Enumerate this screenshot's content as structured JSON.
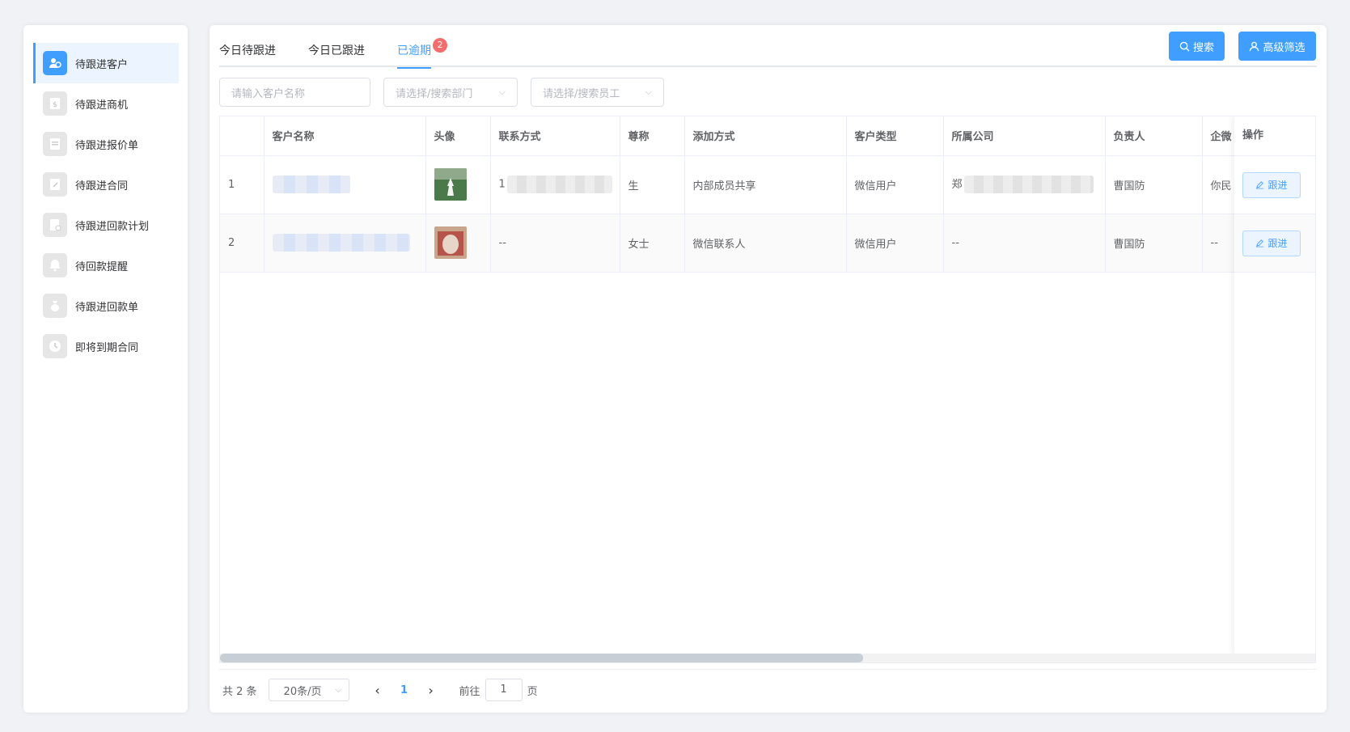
{
  "sidebar": {
    "items": [
      {
        "label": "待跟进客户",
        "icon": "customer-icon",
        "active": true
      },
      {
        "label": "待跟进商机",
        "icon": "opportunity-icon",
        "active": false
      },
      {
        "label": "待跟进报价单",
        "icon": "quote-icon",
        "active": false
      },
      {
        "label": "待跟进合同",
        "icon": "contract-icon",
        "active": false
      },
      {
        "label": "待跟进回款计划",
        "icon": "payment-plan-icon",
        "active": false
      },
      {
        "label": "待回款提醒",
        "icon": "bell-icon",
        "active": false
      },
      {
        "label": "待跟进回款单",
        "icon": "money-bag-icon",
        "active": false
      },
      {
        "label": "即将到期合同",
        "icon": "clock-icon",
        "active": false
      }
    ]
  },
  "tabs": [
    {
      "label": "今日待跟进"
    },
    {
      "label": "今日已跟进"
    },
    {
      "label": "已逾期",
      "badge": "2",
      "active": true
    }
  ],
  "toolbar": {
    "search_label": "搜索",
    "advanced_label": "高级筛选"
  },
  "filters": {
    "customer_placeholder": "请输入客户名称",
    "dept_placeholder": "请选择/搜索部门",
    "staff_placeholder": "请选择/搜索员工"
  },
  "table": {
    "headers": [
      "",
      "客户名称",
      "头像",
      "联系方式",
      "尊称",
      "添加方式",
      "客户类型",
      "所属公司",
      "负责人",
      "企微"
    ],
    "op_header": "操作",
    "rows": [
      {
        "index": "1",
        "name": "",
        "contact_prefix": "1",
        "title": "生",
        "add_method": "内部成员共享",
        "type": "微信用户",
        "company_prefix": "郑",
        "owner": "曹国防",
        "wecom": "你民"
      },
      {
        "index": "2",
        "name": "",
        "contact_prefix": "--",
        "title": "女士",
        "add_method": "微信联系人",
        "type": "微信用户",
        "company_prefix": "--",
        "owner": "曹国防",
        "wecom": "--"
      }
    ],
    "follow_label": "跟进"
  },
  "pagination": {
    "total": "共 2 条",
    "page_size": "20条/页",
    "current": "1",
    "goto_label": "前往",
    "goto_value": "1",
    "page_suffix": "页"
  },
  "colors": {
    "primary": "#409eff",
    "badge": "#f56c6c"
  }
}
